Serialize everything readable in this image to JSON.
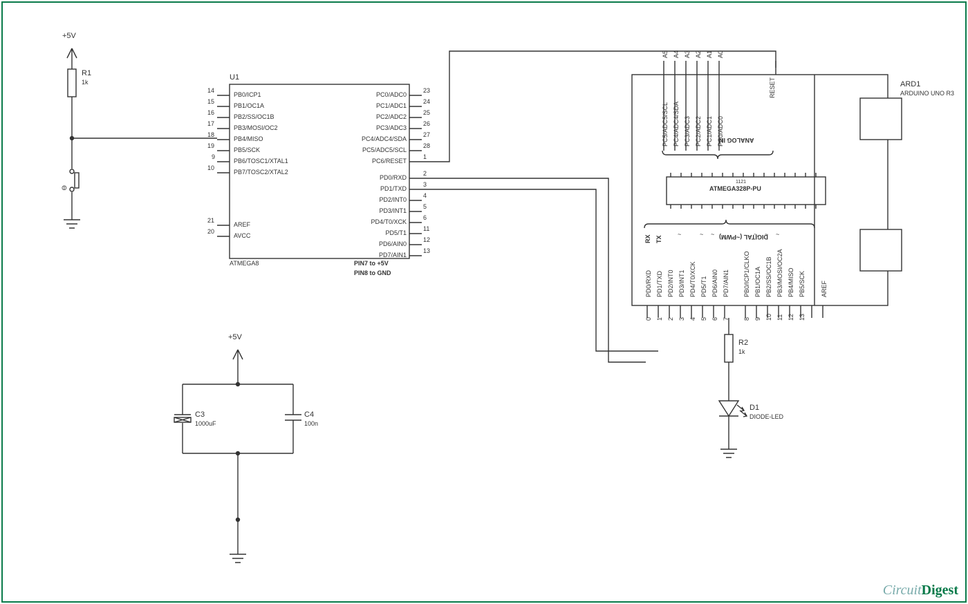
{
  "power_label_top": "+5V",
  "power_label_mid": "+5V",
  "r1": {
    "ref": "R1",
    "val": "1k"
  },
  "r2": {
    "ref": "R2",
    "val": "1k"
  },
  "c3": {
    "ref": "C3",
    "val": "1000uF"
  },
  "c4": {
    "ref": "C4",
    "val": "100n"
  },
  "d1": {
    "ref": "D1",
    "val": "DIODE-LED"
  },
  "u1": {
    "ref": "U1",
    "part": "ATMEGA8",
    "note1": "PIN7 to +5V",
    "note2": "PIN8 to GND",
    "left_pins": [
      {
        "n": "14",
        "name": "PB0/ICP1"
      },
      {
        "n": "15",
        "name": "PB1/OC1A"
      },
      {
        "n": "16",
        "name": "PB2/SS/OC1B"
      },
      {
        "n": "17",
        "name": "PB3/MOSI/OC2"
      },
      {
        "n": "18",
        "name": "PB4/MISO"
      },
      {
        "n": "19",
        "name": "PB5/SCK"
      },
      {
        "n": "9",
        "name": "PB6/TOSC1/XTAL1"
      },
      {
        "n": "10",
        "name": "PB7/TOSC2/XTAL2"
      },
      {
        "n": "21",
        "name": "AREF"
      },
      {
        "n": "20",
        "name": "AVCC"
      }
    ],
    "right_pins": [
      {
        "n": "23",
        "name": "PC0/ADC0"
      },
      {
        "n": "24",
        "name": "PC1/ADC1"
      },
      {
        "n": "25",
        "name": "PC2/ADC2"
      },
      {
        "n": "26",
        "name": "PC3/ADC3"
      },
      {
        "n": "27",
        "name": "PC4/ADC4/SDA"
      },
      {
        "n": "28",
        "name": "PC5/ADC5/SCL"
      },
      {
        "n": "1",
        "name": "PC6/RESET"
      },
      {
        "n": "2",
        "name": "PD0/RXD"
      },
      {
        "n": "3",
        "name": "PD1/TXD"
      },
      {
        "n": "4",
        "name": "PD2/INT0"
      },
      {
        "n": "5",
        "name": "PD3/INT1"
      },
      {
        "n": "6",
        "name": "PD4/T0/XCK"
      },
      {
        "n": "11",
        "name": "PD5/T1"
      },
      {
        "n": "12",
        "name": "PD6/AIN0"
      },
      {
        "n": "13",
        "name": "PD7/AIN1"
      }
    ]
  },
  "ard1": {
    "ref": "ARD1",
    "part": "ARDUINO UNO R3",
    "chip_label": "ATMEGA328P-PU",
    "chip_sub": "1121",
    "analog_header": "ANALOG IN",
    "digital_header": "DIGITAL (~PWM)",
    "reset": "RESET",
    "rx": "RX",
    "tx": "TX",
    "analog_outer": [
      "A5",
      "A4",
      "A3",
      "A2",
      "A1",
      "A0"
    ],
    "analog_inner": [
      "PC5/ADC5/SCL",
      "PC4/ADC4/SDA",
      "PC3/ADC3",
      "PC2/ADC2",
      "PC1/ADC1",
      "PC0/ADC0"
    ],
    "digital_inner": [
      "PD0/RXD",
      "PD1/TXD",
      "PD2/INT0",
      "PD3/INT1",
      "PD4/T0/XCK",
      "PD5/T1",
      "PD6/AIN0",
      "PD7/AIN1",
      "PB0/ICP1/CLKO",
      "PB1/OC1A",
      "PB2/SS/OC1B",
      "PB3/MOSI/OC2A",
      "PB4/MISO",
      "PB5/SCK",
      "",
      "AREF"
    ],
    "digital_outer": [
      "0",
      "1",
      "2",
      "3",
      "4",
      "5",
      "6",
      "7",
      "8",
      "9",
      "10",
      "11",
      "12",
      "13",
      "",
      ""
    ],
    "tilde_positions": [
      3,
      5,
      6,
      9,
      10,
      11
    ]
  },
  "watermark_a": "Circuit",
  "watermark_b": "Digest"
}
